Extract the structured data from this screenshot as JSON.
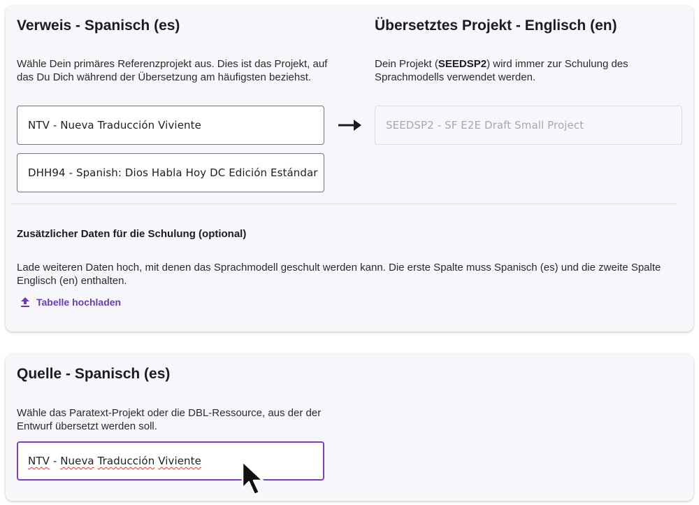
{
  "reference_card": {
    "reference_title": "Verweis - Spanisch (es)",
    "reference_desc": "Wähle Dein primäres Referenzprojekt aus. Dies ist das Projekt, auf das Du Dich während der Übersetzung am häufigsten beziehst.",
    "primary_reference_value": "NTV - Nueva Traducción Viviente",
    "secondary_reference_value": "DHH94 - Spanish: Dios Habla Hoy DC Edición Estándar",
    "translated_title": "Übersetztes Projekt - Englisch (en)",
    "translated_desc_prefix": "Dein Projekt (",
    "translated_desc_code": "SEEDSP2",
    "translated_desc_suffix": ") wird immer zur Schulung des Sprachmodells verwendet werden.",
    "translated_project_value": "SEEDSP2 - SF E2E Draft Small Project",
    "additional_title": "Zusätzlicher Daten für die Schulung (optional)",
    "additional_desc": "Lade weiteren Daten hoch, mit denen das Sprachmodell geschult werden kann. Die erste Spalte muss Spanisch (es) und die zweite Spalte Englisch (en) enthalten.",
    "upload_label": "Tabelle hochladen",
    "upload_icon": "upload-icon",
    "arrow_icon": "arrow-right-icon"
  },
  "source_card": {
    "source_title": "Quelle - Spanisch (es)",
    "source_desc": "Wähle das Paratext-Projekt oder die DBL-Ressource, aus der der Entwurf übersetzt werden soll.",
    "source_code": "NTV",
    "source_separator": " - ",
    "source_word1": "Nueva",
    "source_word2": "Traducción",
    "source_word3": "Viviente"
  },
  "colors": {
    "accent": "#7f3fbf",
    "link": "#6a3cb0",
    "card_bg": "#f7f6fa",
    "spellcheck": "#e53935"
  },
  "cursor_icon": "mouse-pointer-icon"
}
